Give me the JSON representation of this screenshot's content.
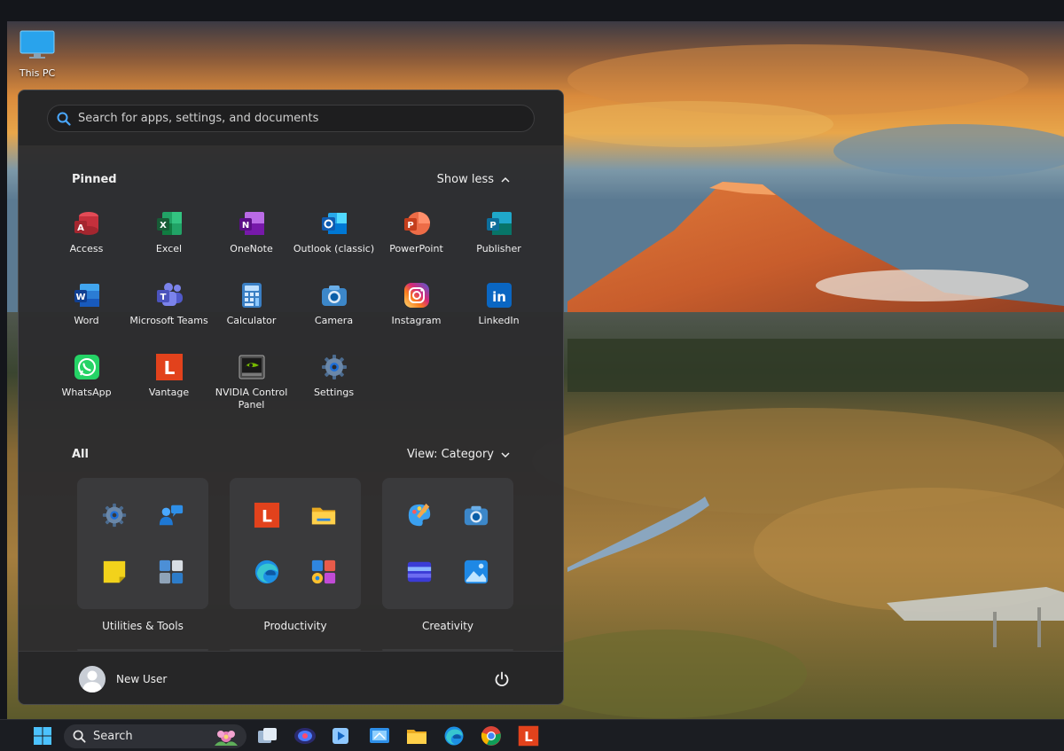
{
  "desktop": {
    "icon_label": "This PC",
    "icon": "monitor-icon"
  },
  "start_menu": {
    "search_placeholder": "Search for apps, settings, and documents",
    "pinned": {
      "title": "Pinned",
      "toggle_label": "Show less",
      "apps": [
        {
          "label": "Access",
          "icon": "access-icon"
        },
        {
          "label": "Excel",
          "icon": "excel-icon"
        },
        {
          "label": "OneNote",
          "icon": "onenote-icon"
        },
        {
          "label": "Outlook (classic)",
          "icon": "outlook-icon"
        },
        {
          "label": "PowerPoint",
          "icon": "powerpoint-icon"
        },
        {
          "label": "Publisher",
          "icon": "publisher-icon"
        },
        {
          "label": "Word",
          "icon": "word-icon"
        },
        {
          "label": "Microsoft Teams",
          "icon": "teams-icon"
        },
        {
          "label": "Calculator",
          "icon": "calculator-icon"
        },
        {
          "label": "Camera",
          "icon": "camera-icon"
        },
        {
          "label": "Instagram",
          "icon": "instagram-icon"
        },
        {
          "label": "LinkedIn",
          "icon": "linkedin-icon"
        },
        {
          "label": "WhatsApp",
          "icon": "whatsapp-icon"
        },
        {
          "label": "Vantage",
          "icon": "vantage-icon"
        },
        {
          "label": "NVIDIA Control Panel",
          "icon": "nvidia-icon"
        },
        {
          "label": "Settings",
          "icon": "settings-gear-icon"
        }
      ]
    },
    "all": {
      "title": "All",
      "view_label": "View: Category",
      "categories": [
        {
          "label": "Utilities & Tools",
          "icons": [
            "settings-gear-icon",
            "get-help-icon",
            "sticky-notes-icon",
            "utilities-folder-icon"
          ]
        },
        {
          "label": "Productivity",
          "icons": [
            "vantage-icon",
            "file-explorer-icon",
            "edge-icon",
            "productivity-folder-icon"
          ]
        },
        {
          "label": "Creativity",
          "icons": [
            "paint-icon",
            "camera-icon",
            "clipchamp-icon",
            "photos-icon"
          ]
        }
      ]
    },
    "user_name": "New User"
  },
  "taskbar": {
    "search_label": "Search",
    "items": [
      "start-icon",
      "task-view-icon",
      "media-player-icon",
      "video-player-icon",
      "screen-tool-icon",
      "file-explorer-icon",
      "edge-icon",
      "chrome-icon",
      "vantage-icon"
    ]
  },
  "colors": {
    "menu_bg": "#2c2c2e",
    "taskbar_bg": "#1b1d22",
    "accent": "#0a78d4"
  }
}
